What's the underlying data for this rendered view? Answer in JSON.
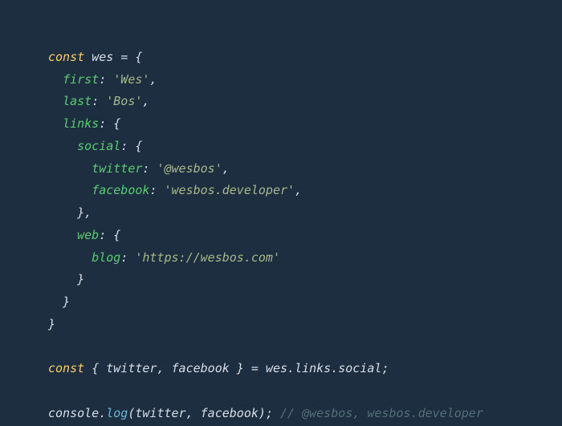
{
  "code": {
    "line1": {
      "const": "const",
      "varname": "wes",
      "eq": " = ",
      "brace": "{"
    },
    "line2": {
      "indent": "  ",
      "prop": "first",
      "colon": ": ",
      "val": "'Wes'",
      "comma": ","
    },
    "line3": {
      "indent": "  ",
      "prop": "last",
      "colon": ": ",
      "val": "'Bos'",
      "comma": ","
    },
    "line4": {
      "indent": "  ",
      "prop": "links",
      "colon": ": ",
      "brace": "{"
    },
    "line5": {
      "indent": "    ",
      "prop": "social",
      "colon": ": ",
      "brace": "{"
    },
    "line6": {
      "indent": "      ",
      "prop": "twitter",
      "colon": ": ",
      "val": "'@wesbos'",
      "comma": ","
    },
    "line7": {
      "indent": "      ",
      "prop": "facebook",
      "colon": ": ",
      "val": "'wesbos.developer'",
      "comma": ","
    },
    "line8": {
      "indent": "    ",
      "brace": "},"
    },
    "line9": {
      "indent": "    ",
      "prop": "web",
      "colon": ": ",
      "brace": "{"
    },
    "line10": {
      "indent": "      ",
      "prop": "blog",
      "colon": ": ",
      "val": "'https://wesbos.com'"
    },
    "line11": {
      "indent": "    ",
      "brace": "}"
    },
    "line12": {
      "indent": "  ",
      "brace": "}"
    },
    "line13": {
      "brace": "}"
    },
    "line14": {
      "const": "const",
      "space": " ",
      "lbrace": "{ ",
      "v1": "twitter",
      "comma1": ", ",
      "v2": "facebook",
      "rbrace": " }",
      "eq": " = ",
      "obj1": "wes",
      "dot1": ".",
      "obj2": "links",
      "dot2": ".",
      "obj3": "social",
      "semi": ";"
    },
    "line15": {
      "obj": "console",
      "dot": ".",
      "method": "log",
      "lparen": "(",
      "v1": "twitter",
      "comma": ", ",
      "v2": "facebook",
      "rparen": ")",
      "semi": ";",
      "space": " ",
      "comment": "// @wesbos, wesbos.developer"
    }
  }
}
